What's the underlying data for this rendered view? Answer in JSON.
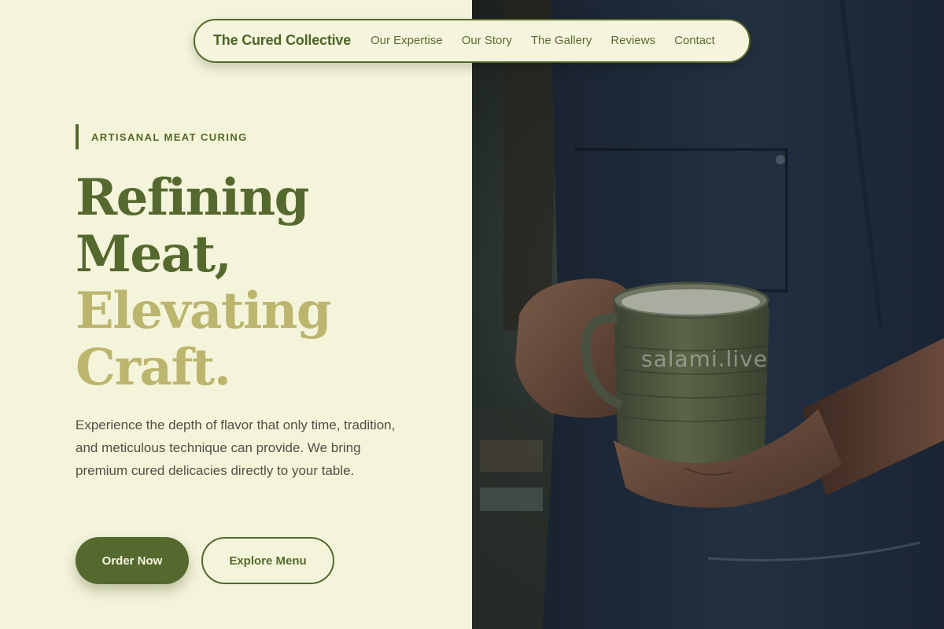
{
  "nav": {
    "brand": "The Cured Collective",
    "links": [
      "Our Expertise",
      "Our Story",
      "The Gallery",
      "Reviews",
      "Contact"
    ]
  },
  "hero": {
    "eyebrow": "ARTISANAL MEAT CURING",
    "headline_line1": "Refining",
    "headline_line2": "Meat,",
    "headline_line3": "Elevating",
    "headline_line4": "Craft.",
    "description": "Experience the depth of flavor that only time, tradition, and meticulous technique can provide. We bring premium cured delicacies directly to your table.",
    "primary_cta": "Order Now",
    "secondary_cta": "Explore Menu"
  },
  "image": {
    "watermark": "salami.live"
  },
  "colors": {
    "accent": "#55692e",
    "accent_light": "#bcb56e",
    "background": "#f4f4da"
  }
}
